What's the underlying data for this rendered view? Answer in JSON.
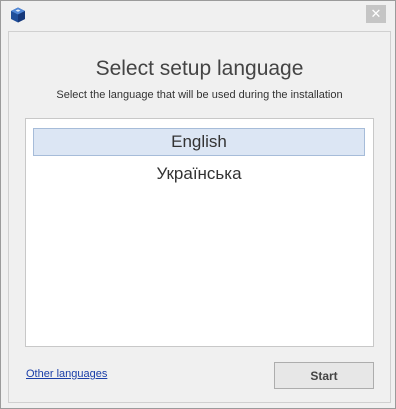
{
  "window": {
    "app_icon": "cube-logo-icon",
    "close_icon": "close-icon",
    "close_glyph": "✕"
  },
  "header": {
    "title": "Select setup language",
    "subtitle": "Select the language that will be used during the installation"
  },
  "languages": [
    {
      "label": "English",
      "selected": true
    },
    {
      "label": "Українська",
      "selected": false
    }
  ],
  "footer": {
    "other_link": "Other languages",
    "start_label": "Start"
  },
  "colors": {
    "accent_selection": "#dce6f4",
    "link": "#1a3ea8",
    "icon_blue": "#1f4e9a"
  }
}
